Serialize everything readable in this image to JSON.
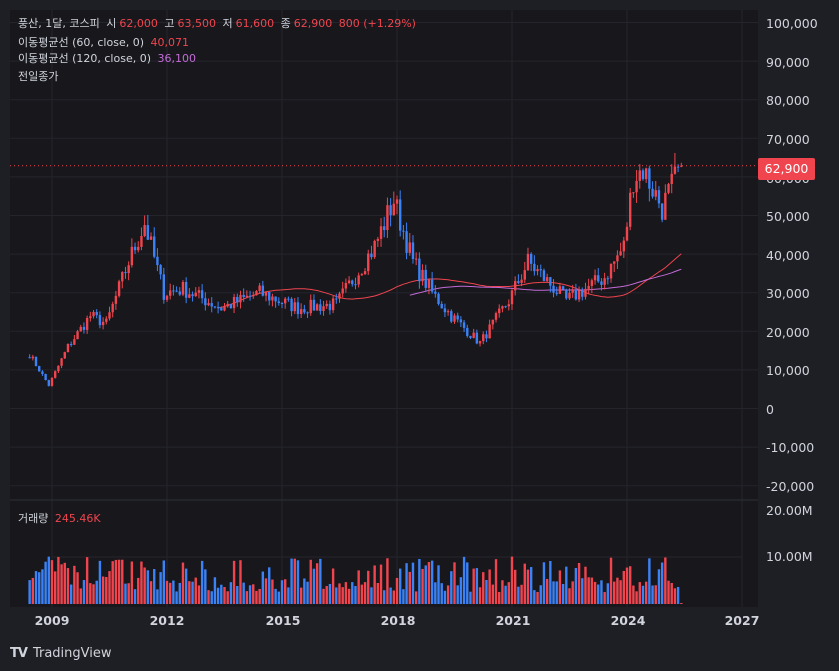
{
  "legend": {
    "symbol": "풍산, 1달, 코스피",
    "open_label": "시",
    "open": "62,000",
    "high_label": "고",
    "high": "63,500",
    "low_label": "저",
    "low": "61,600",
    "close_label": "종",
    "close": "62,900",
    "change": "800 (+1.29%)",
    "ma60_label": "이동평균선 (60, close, 0)",
    "ma60_value": "40,071",
    "ma120_label": "이동평균선 (120, close, 0)",
    "ma120_value": "36,100",
    "prev_close_label": "전일종가"
  },
  "volume": {
    "label": "거래량",
    "value": "245.46K",
    "axis": [
      "20.00M",
      "10.00M"
    ]
  },
  "price_axis": [
    "100,000",
    "90,000",
    "80,000",
    "70,000",
    "60,000",
    "50,000",
    "40,000",
    "30,000",
    "20,000",
    "10,000",
    "0",
    "-10,000",
    "-20,000"
  ],
  "price_tag": "62,900",
  "time_axis": [
    "2009",
    "2012",
    "2015",
    "2018",
    "2021",
    "2024",
    "2027"
  ],
  "footer": {
    "brand": "TradingView",
    "logo": "TV"
  },
  "colors": {
    "up": "#f0454e",
    "down": "#3b82f6",
    "ma60": "#f0454e",
    "ma120": "#c46bd8",
    "background": "#17171c"
  },
  "chart_data": {
    "type": "candlestick",
    "interval": "1 month",
    "x_range": [
      "2008-06",
      "2025-06"
    ],
    "price_ylim": [
      -20000,
      100000
    ],
    "current_close": 62900,
    "key_closes": [
      {
        "date": "2008-06",
        "close": 14000
      },
      {
        "date": "2008-12",
        "close": 6000
      },
      {
        "date": "2009-06",
        "close": 16000
      },
      {
        "date": "2010-01",
        "close": 24000
      },
      {
        "date": "2010-06",
        "close": 22000
      },
      {
        "date": "2011-01",
        "close": 38000
      },
      {
        "date": "2011-06",
        "close": 48000
      },
      {
        "date": "2011-12",
        "close": 30000
      },
      {
        "date": "2012-06",
        "close": 31000
      },
      {
        "date": "2013-06",
        "close": 26000
      },
      {
        "date": "2014-06",
        "close": 30000
      },
      {
        "date": "2015-06",
        "close": 26000
      },
      {
        "date": "2016-06",
        "close": 27000
      },
      {
        "date": "2017-06",
        "close": 42000
      },
      {
        "date": "2017-12",
        "close": 54000
      },
      {
        "date": "2018-06",
        "close": 38000
      },
      {
        "date": "2018-12",
        "close": 30000
      },
      {
        "date": "2019-06",
        "close": 24000
      },
      {
        "date": "2020-03",
        "close": 17000
      },
      {
        "date": "2020-12",
        "close": 28000
      },
      {
        "date": "2021-06",
        "close": 38000
      },
      {
        "date": "2022-06",
        "close": 28000
      },
      {
        "date": "2023-06",
        "close": 34000
      },
      {
        "date": "2023-12",
        "close": 42000
      },
      {
        "date": "2024-03",
        "close": 60000
      },
      {
        "date": "2024-06",
        "close": 62000
      },
      {
        "date": "2024-12",
        "close": 52000
      },
      {
        "date": "2025-06",
        "close": 62900
      }
    ],
    "ma60_end": 40071,
    "ma120_end": 36100,
    "volume_ylim": [
      0,
      22000000
    ],
    "volume_current": 245460
  }
}
